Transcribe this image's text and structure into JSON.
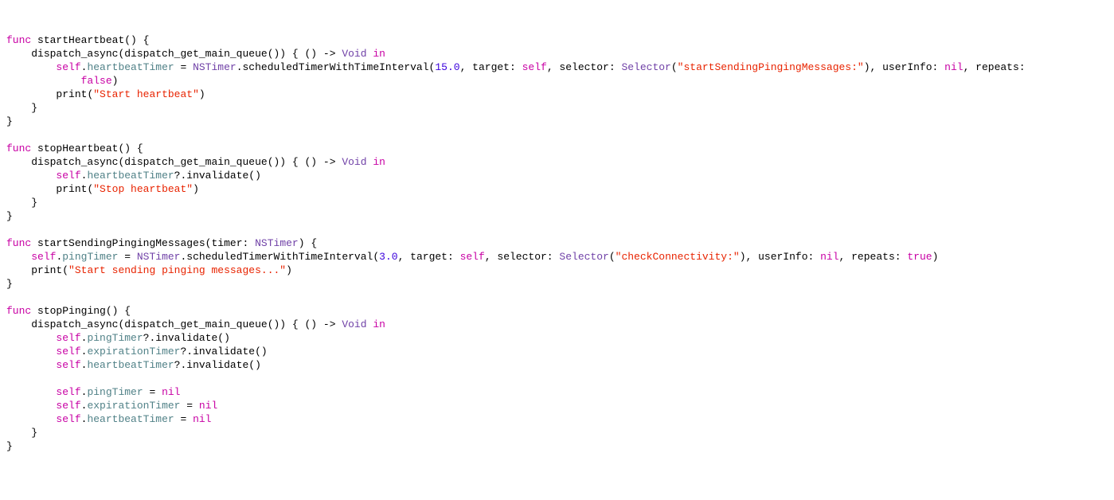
{
  "code": {
    "funcKw": "func",
    "selfKw": "self",
    "nilKw": "nil",
    "trueKw": "true",
    "falseKw": "false",
    "inKw": "in",
    "voidType": "Void",
    "nstimerType": "NSTimer",
    "selectorType": "Selector",
    "startHeartbeat": {
      "name": "startHeartbeat",
      "dispatchAsync": "dispatch_async",
      "dispatchGetMain": "dispatch_get_main_queue",
      "heartbeatTimer": "heartbeatTimer",
      "scheduled": "scheduledTimerWithTimeInterval",
      "interval": "15.0",
      "targetLabel": ", target: ",
      "selectorLabel": ", selector: ",
      "selectorStr": "\"startSendingPingingMessages:\"",
      "userInfoLabel": ", userInfo: ",
      "repeatsLabel": ", repeats: ",
      "printStr": "\"Start heartbeat\"",
      "printFn": "print"
    },
    "stopHeartbeat": {
      "name": "stopHeartbeat",
      "dispatchAsync": "dispatch_async",
      "dispatchGetMain": "dispatch_get_main_queue",
      "heartbeatTimer": "heartbeatTimer",
      "invalidate": "invalidate",
      "printStr": "\"Stop heartbeat\"",
      "printFn": "print"
    },
    "startSending": {
      "name": "startSendingPingingMessages",
      "paramLabel": "timer",
      "pingTimer": "pingTimer",
      "scheduled": "scheduledTimerWithTimeInterval",
      "interval": "3.0",
      "targetLabel": ", target: ",
      "selectorLabel": ", selector: ",
      "selectorStr": "\"checkConnectivity:\"",
      "userInfoLabel": ", userInfo: ",
      "repeatsLabel": ", repeats: ",
      "printStr": "\"Start sending pinging messages...\"",
      "printFn": "print"
    },
    "stopPinging": {
      "name": "stopPinging",
      "dispatchAsync": "dispatch_async",
      "dispatchGetMain": "dispatch_get_main_queue",
      "pingTimer": "pingTimer",
      "expirationTimer": "expirationTimer",
      "heartbeatTimer": "heartbeatTimer",
      "invalidate": "invalidate"
    }
  }
}
